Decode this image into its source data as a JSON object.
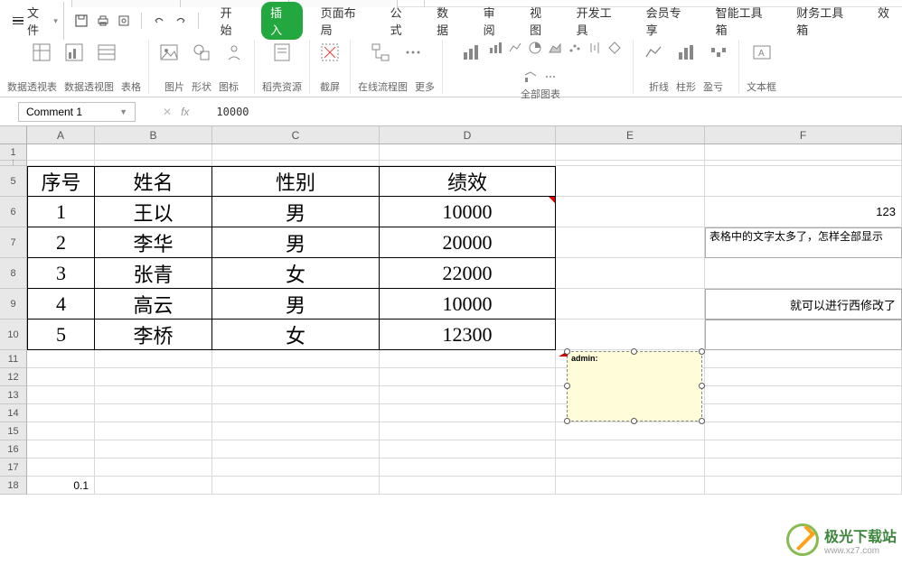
{
  "titlebar": {
    "tabs": [
      "",
      "",
      "",
      "",
      ""
    ]
  },
  "menubar": {
    "file": "文件",
    "tabs": [
      "开始",
      "插入",
      "页面布局",
      "公式",
      "数据",
      "审阅",
      "视图",
      "开发工具",
      "会员专享",
      "智能工具箱",
      "财务工具箱",
      "效"
    ],
    "active_index": 1
  },
  "ribbon": {
    "groups": [
      {
        "labels": [
          "数据透视表",
          "数据透视图",
          "表格"
        ]
      },
      {
        "labels": [
          "图片",
          "形状",
          "图标"
        ]
      },
      {
        "labels": [
          "稻壳资源"
        ]
      },
      {
        "labels": [
          "截屏"
        ]
      },
      {
        "labels": [
          "在线流程图",
          "更多"
        ]
      },
      {
        "labels": [
          "全部图表"
        ]
      },
      {
        "labels": [
          "折线",
          "柱形",
          "盈亏"
        ]
      },
      {
        "labels": [
          "文本框"
        ]
      }
    ]
  },
  "formula": {
    "name_box": "Comment 1",
    "fx_label": "fx",
    "value": "10000"
  },
  "grid": {
    "columns": [
      "A",
      "B",
      "C",
      "D",
      "E",
      "F"
    ],
    "headers": [
      "序号",
      "姓名",
      "性别",
      "绩效"
    ],
    "data": [
      {
        "n": "1",
        "name": "王以",
        "sex": "男",
        "val": "10000"
      },
      {
        "n": "2",
        "name": "李华",
        "sex": "男",
        "val": "20000"
      },
      {
        "n": "3",
        "name": "张青",
        "sex": "女",
        "val": "22000"
      },
      {
        "n": "4",
        "name": "高云",
        "sex": "男",
        "val": "10000"
      },
      {
        "n": "5",
        "name": "李桥",
        "sex": "女",
        "val": "12300"
      }
    ],
    "f6": "123",
    "f7": "表格中的文字太多了，怎样全部显示",
    "f9": "就可以进行西修改了",
    "a18": "0.1"
  },
  "comment": {
    "author": "admin:"
  },
  "watermark": {
    "t1": "极光下载站",
    "t2": "www.xz7.com"
  }
}
